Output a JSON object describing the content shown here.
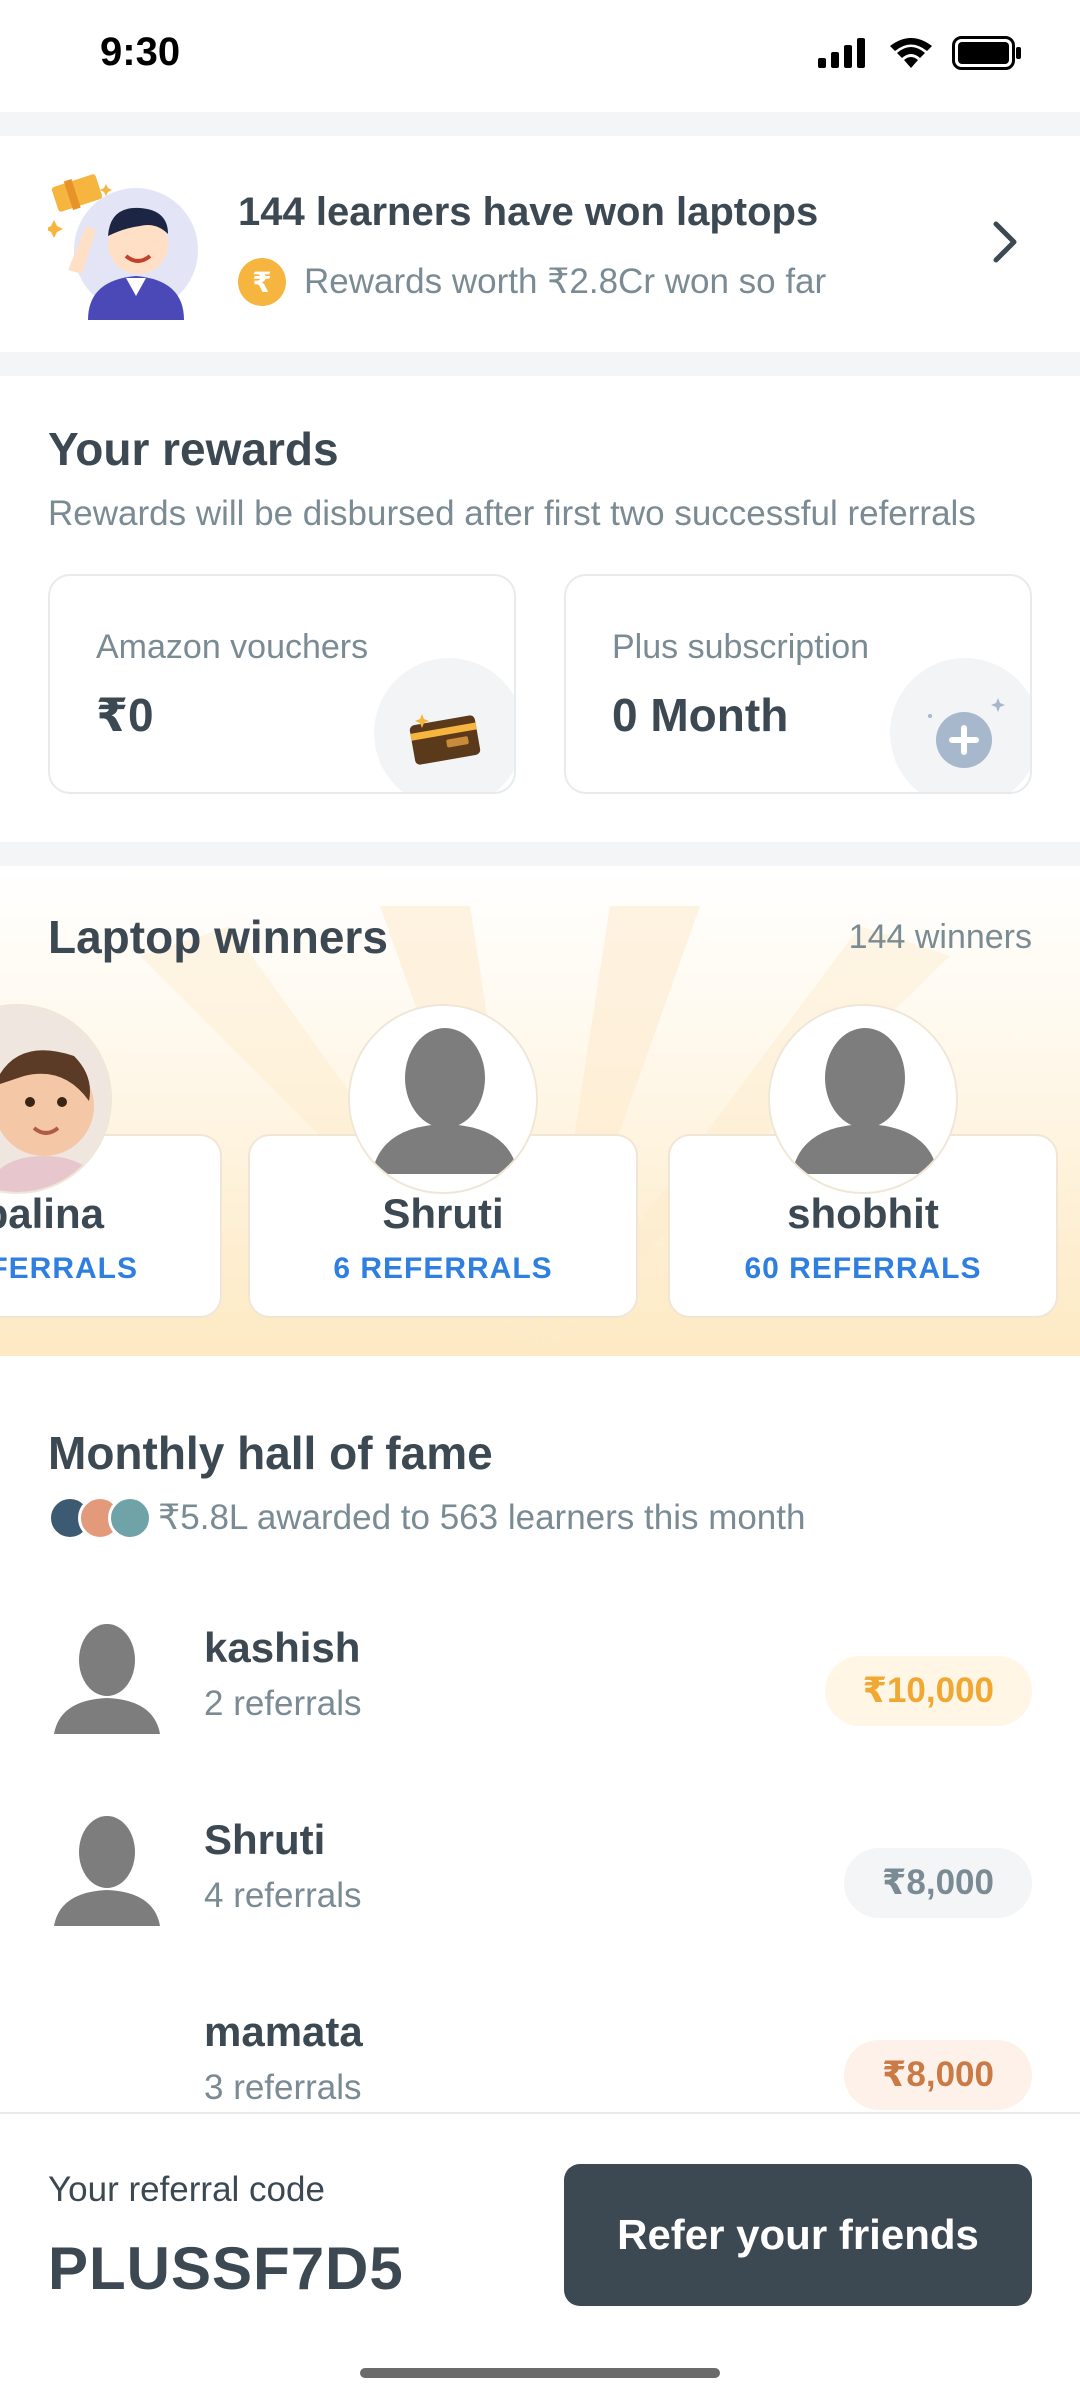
{
  "status_bar": {
    "time": "9:30"
  },
  "banner": {
    "title": "144 learners have won laptops",
    "coin_symbol": "₹",
    "subtitle": "Rewards worth ₹2.8Cr won so far"
  },
  "rewards": {
    "title": "Your rewards",
    "description": "Rewards will be disbursed after first two successful referrals",
    "cards": [
      {
        "label": "Amazon vouchers",
        "value": "₹0",
        "icon": "voucher-card-icon"
      },
      {
        "label": "Plus subscription",
        "value": "0 Month",
        "icon": "plus-badge-icon"
      }
    ]
  },
  "laptop_winners": {
    "title": "Laptop winners",
    "count": "144 winners",
    "winners": [
      {
        "name": "palina",
        "referrals": "FERRALS"
      },
      {
        "name": "Shruti",
        "referrals": "6 REFERRALS"
      },
      {
        "name": "shobhit",
        "referrals": "60 REFERRALS"
      }
    ]
  },
  "hall_of_fame": {
    "title": "Monthly hall of fame",
    "summary": "₹5.8L awarded to 563 learners this month",
    "entries": [
      {
        "name": "kashish",
        "referrals": "2 referrals",
        "amount": "₹10,000",
        "badge_bg": "#fff6e6",
        "badge_color": "#f0a832"
      },
      {
        "name": "Shruti",
        "referrals": "4 referrals",
        "amount": "₹8,000",
        "badge_bg": "#f3f5f7",
        "badge_color": "#7a8b94"
      },
      {
        "name": "mamata",
        "referrals": "3 referrals",
        "amount": "₹8,000",
        "badge_bg": "#fdf1ea",
        "badge_color": "#c97a45"
      }
    ]
  },
  "bottom_bar": {
    "code_label": "Your referral code",
    "code": "PLUSSF7D5",
    "cta": "Refer your friends"
  }
}
